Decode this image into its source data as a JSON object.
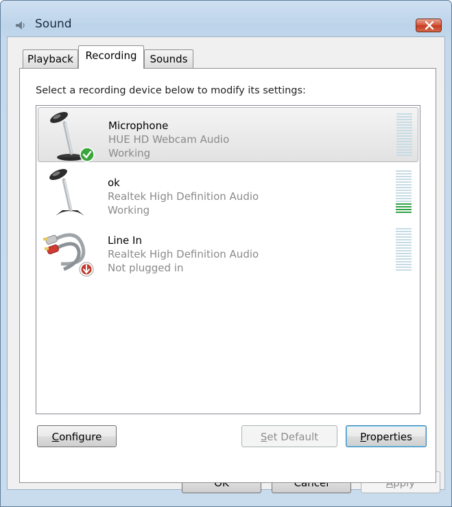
{
  "window": {
    "title": "Sound"
  },
  "tabs": [
    {
      "label": "Playback"
    },
    {
      "label": "Recording"
    },
    {
      "label": "Sounds"
    }
  ],
  "panel": {
    "instruction": "Select a recording device below to modify its settings:"
  },
  "devices": [
    {
      "name": "Microphone",
      "description": "HUE HD Webcam Audio",
      "status": "Working",
      "icon": "microphone-icon",
      "badge": "default-check-icon",
      "selected": true,
      "level_fraction": 0.0
    },
    {
      "name": "ok",
      "description": "Realtek High Definition Audio",
      "status": "Working",
      "icon": "microphone-icon",
      "badge": "",
      "selected": false,
      "level_fraction": 0.25
    },
    {
      "name": "Line In",
      "description": "Realtek High Definition Audio",
      "status": "Not plugged in",
      "icon": "line-in-cable-icon",
      "badge": "unplugged-arrow-icon",
      "selected": false,
      "level_fraction": 0.0
    }
  ],
  "panel_buttons": {
    "configure": {
      "mnemonic": "C",
      "rest": "onfigure"
    },
    "set_default": {
      "mnemonic": "S",
      "rest": "et Default"
    },
    "properties": {
      "mnemonic": "P",
      "rest": "roperties"
    }
  },
  "dialog_buttons": {
    "ok": "OK",
    "cancel": "Cancel",
    "apply": {
      "mnemonic": "A",
      "rest": "pply"
    }
  },
  "colors": {
    "meter_on": "#2fa045",
    "meter_off": "#c6dbe4",
    "check": "#3aa53a",
    "unplugged": "#c0392b"
  }
}
